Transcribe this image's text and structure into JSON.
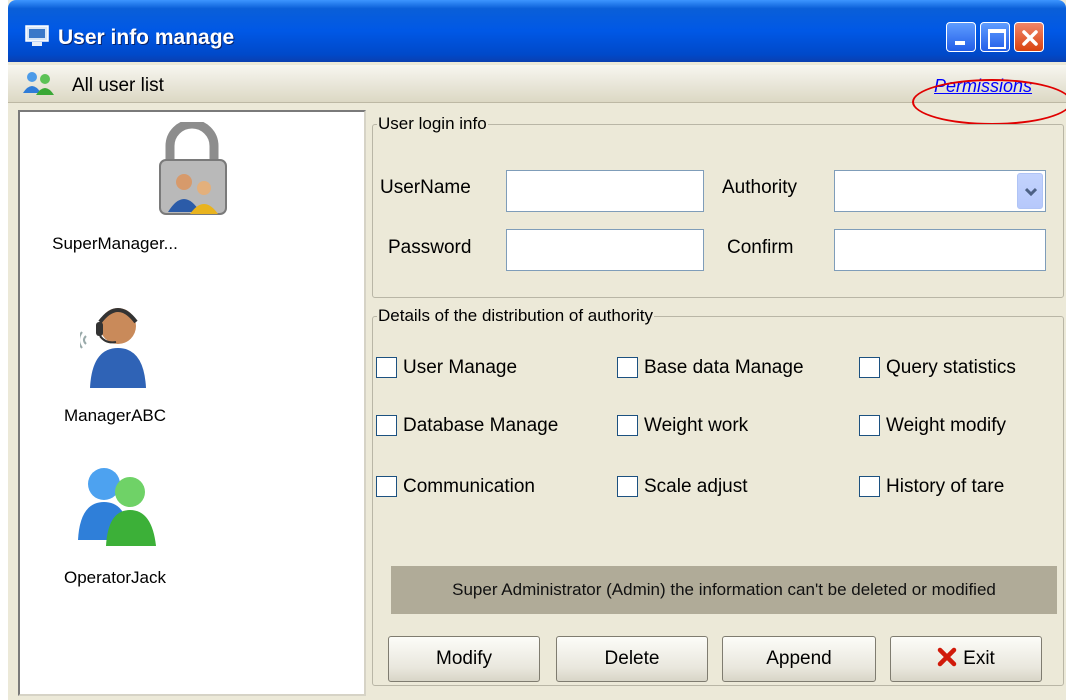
{
  "window": {
    "title": "User info manage"
  },
  "toolbar": {
    "all_users_label": "All user list",
    "permissions_link": "Permissions"
  },
  "users": [
    {
      "name": "SuperManager...",
      "icon": "lock-user-icon"
    },
    {
      "name": "ManagerABC",
      "icon": "headset-user-icon"
    },
    {
      "name": "OperatorJack",
      "icon": "two-users-icon"
    }
  ],
  "login_info": {
    "legend": "User login info",
    "username_label": "UserName",
    "username_value": "",
    "authority_label": "Authority",
    "authority_value": "",
    "password_label": "Password",
    "password_value": "",
    "confirm_label": "Confirm",
    "confirm_value": ""
  },
  "authority_details": {
    "legend": "Details of the distribution of authority",
    "checkboxes": [
      {
        "label": "User Manage",
        "checked": false
      },
      {
        "label": "Base data Manage",
        "checked": false
      },
      {
        "label": "Query statistics",
        "checked": false
      },
      {
        "label": "Database Manage",
        "checked": false
      },
      {
        "label": "Weight work",
        "checked": false
      },
      {
        "label": "Weight modify",
        "checked": false
      },
      {
        "label": "Communication",
        "checked": false
      },
      {
        "label": "Scale adjust",
        "checked": false
      },
      {
        "label": "History of tare",
        "checked": false
      }
    ]
  },
  "notice": "Super Administrator (Admin) the information can't be deleted or modified",
  "buttons": {
    "modify": "Modify",
    "delete": "Delete",
    "append": "Append",
    "exit": "Exit"
  },
  "colors": {
    "title_bar": "#0058e6",
    "link": "#0000ff",
    "highlight_circle": "#e00000",
    "notice_bg": "#b0ab98"
  }
}
